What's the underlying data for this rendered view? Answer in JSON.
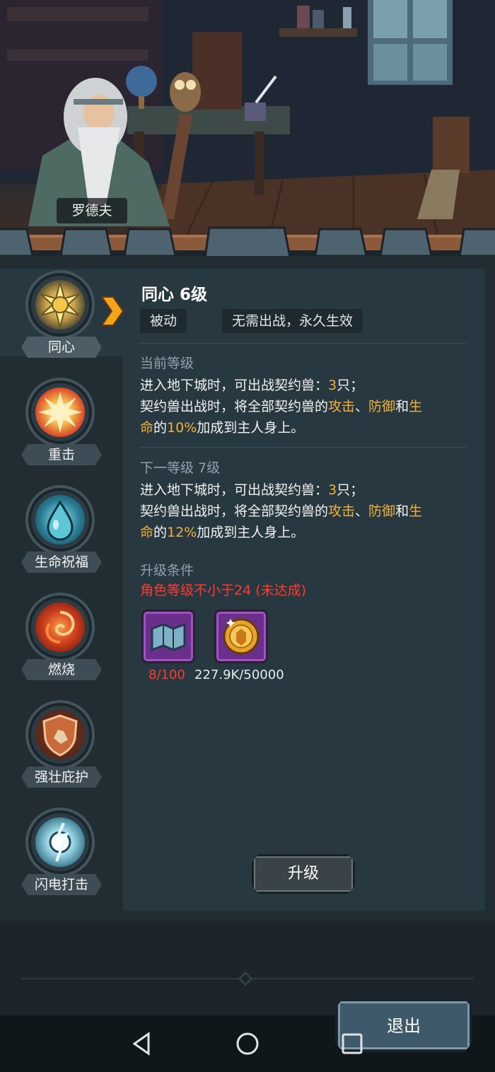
{
  "npc": {
    "name": "罗德夫"
  },
  "skills": [
    {
      "label": "同心",
      "icon": "sun-icon",
      "selected": true
    },
    {
      "label": "重击",
      "icon": "burst-icon",
      "selected": false
    },
    {
      "label": "生命祝福",
      "icon": "water-drop-icon",
      "selected": false
    },
    {
      "label": "燃烧",
      "icon": "fire-swirl-icon",
      "selected": false
    },
    {
      "label": "强壮庇护",
      "icon": "shield-icon",
      "selected": false
    },
    {
      "label": "闪电打击",
      "icon": "lightning-orb-icon",
      "selected": false
    }
  ],
  "detail": {
    "title": "同心 6级",
    "tag_type": "被动",
    "tag_effect": "无需出战，永久生效",
    "current": {
      "heading": "当前等级",
      "line1_a": "进入地下城时，可出战契约兽：",
      "line1_num": "3",
      "line1_b": "只；",
      "line2_a": "契约兽出战时，将全部契约兽的",
      "attack": "攻击",
      "sep": "、",
      "defense": "防御",
      "and": "和",
      "life1": "生",
      "life2": "命",
      "of": "的",
      "percent": "10%",
      "tail": "加成到主人身上。"
    },
    "next": {
      "heading": "下一等级 7级",
      "line1_a": "进入地下城时，可出战契约兽：",
      "line1_num": "3",
      "line1_b": "只；",
      "line2_a": "契约兽出战时，将全部契约兽的",
      "attack": "攻击",
      "sep": "、",
      "defense": "防御",
      "and": "和",
      "life1": "生",
      "life2": "命",
      "of": "的",
      "percent": "12%",
      "tail": "加成到主人身上。"
    },
    "upgrade": {
      "heading": "升级条件",
      "requirement": "角色等级不小于24 (未达成)",
      "items": [
        {
          "icon": "scroll-map-icon",
          "count": "8/100",
          "count_color": "#ff3b30"
        },
        {
          "icon": "gold-coin-icon",
          "count": "227.9K/50000",
          "count_color": "#e8ecee"
        }
      ],
      "button": "升级"
    }
  },
  "exit_button": "退出",
  "colors": {
    "highlight": "#f2b13c",
    "warning": "#ff3b30",
    "panel": "#283840"
  }
}
